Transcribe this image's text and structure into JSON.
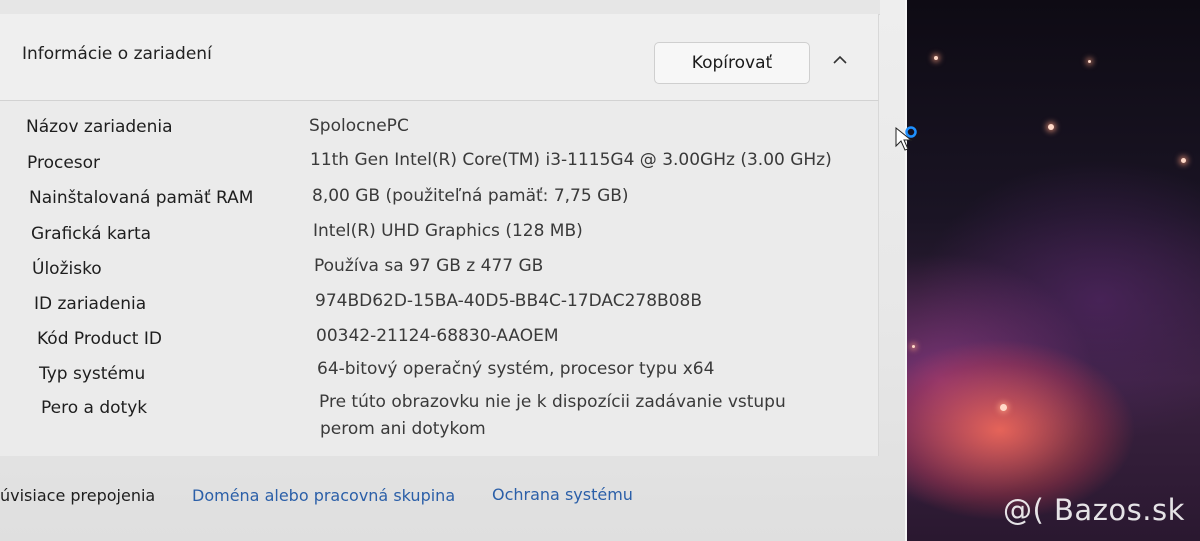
{
  "section": {
    "title": "Informácie o zariadení",
    "copy_label": "Kopírovať"
  },
  "specs": [
    {
      "label": "Názov zariadenia",
      "value": "SpolocnePC"
    },
    {
      "label": "Procesor",
      "value": "11th Gen Intel(R) Core(TM) i3-1115G4 @ 3.00GHz (3.00 GHz)"
    },
    {
      "label": "Nainštalovaná pamäť RAM",
      "value": "8,00 GB (použiteľná pamäť: 7,75 GB)"
    },
    {
      "label": "Grafická karta",
      "value": "Intel(R) UHD Graphics (128 MB)"
    },
    {
      "label": "Úložisko",
      "value": "Používa sa 97 GB z 477 GB"
    },
    {
      "label": "ID zariadenia",
      "value": "974BD62D-15BA-40D5-BB4C-17DAC278B08B"
    },
    {
      "label": "Kód Product ID",
      "value": "00342-21124-68830-AAOEM"
    },
    {
      "label": "Typ systému",
      "value": "64-bitový operačný systém, procesor typu x64"
    },
    {
      "label": "Pero a dotyk",
      "value": "Pre túto obrazovku nie je k dispozícii zadávanie vstupu",
      "value2": "perom ani dotykom"
    }
  ],
  "related": {
    "label": "úvisiace prepojenia",
    "links": [
      "Doména alebo pracovná skupina",
      "Ochrana systému"
    ]
  },
  "watermark": "@( Bazos.sk",
  "colors": {
    "link": "#2b5fa8",
    "panel": "#ebebeb",
    "cursor_ring": "#1e90ff"
  }
}
